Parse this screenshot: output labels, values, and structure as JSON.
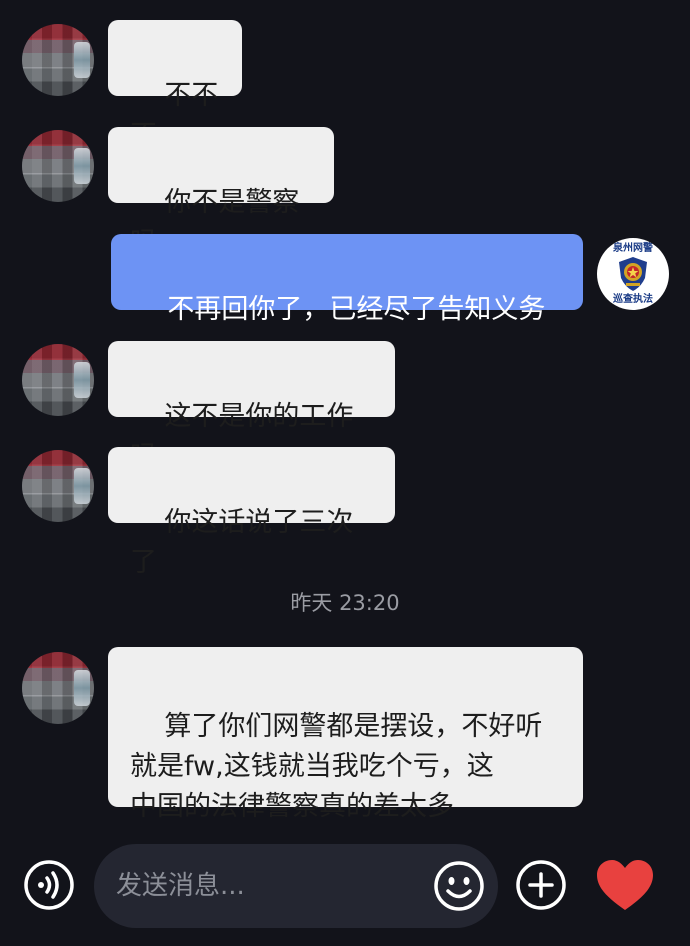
{
  "messages": [
    {
      "sender": "other",
      "text": "不不不"
    },
    {
      "sender": "other",
      "text": "你不是警察吗"
    },
    {
      "sender": "me",
      "text": "不再回你了，已经尽了告知义务"
    },
    {
      "sender": "other",
      "text": "这不是你的工作吗"
    },
    {
      "sender": "other",
      "text": "你这话说了三次了"
    },
    {
      "sender": "other",
      "text": "算了你们网警都是摆设，不好听\n就是fw,这钱就当我吃个亏，这\n中国的法律警察真的差太多"
    }
  ],
  "timestamp": "昨天 23:20",
  "my_avatar": {
    "top_text": "泉州网警",
    "bottom_text": "巡查执法"
  },
  "input": {
    "placeholder": "发送消息..."
  },
  "icons": {
    "voice": "voice-icon",
    "emoji": "emoji-icon",
    "plus": "plus-icon",
    "heart": "heart-icon"
  },
  "colors": {
    "background": "#12131a",
    "my_bubble": "#6d93f4",
    "other_bubble": "#efefef",
    "heart": "#e8413f"
  }
}
